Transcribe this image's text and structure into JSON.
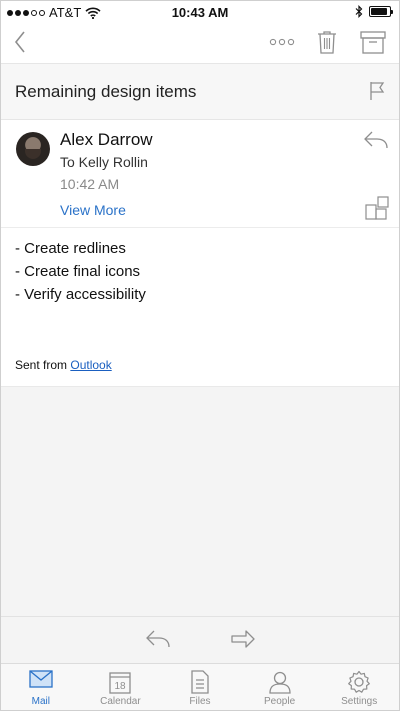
{
  "status": {
    "carrier": "AT&T",
    "time": "10:43 AM",
    "battery_level": 0.9
  },
  "email": {
    "subject": "Remaining design items",
    "sender": "Alex Darrow",
    "to_line": "To Kelly Rollin",
    "time": "10:42 AM",
    "view_more": "View More",
    "body_lines": [
      "- Create redlines",
      "- Create final icons",
      "- Verify accessibility"
    ],
    "signature_prefix": "Sent from ",
    "signature_link": "Outlook"
  },
  "tabs": [
    {
      "label": "Mail",
      "icon": "mail-icon"
    },
    {
      "label": "Calendar",
      "icon": "calendar-icon",
      "date": "18"
    },
    {
      "label": "Files",
      "icon": "files-icon"
    },
    {
      "label": "People",
      "icon": "people-icon"
    },
    {
      "label": "Settings",
      "icon": "settings-icon"
    }
  ],
  "colors": {
    "accent": "#2a72c8",
    "icon_grey": "#8e8e8e"
  }
}
